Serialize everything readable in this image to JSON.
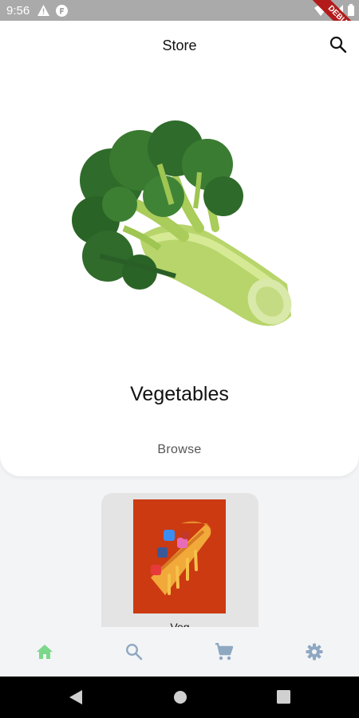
{
  "status_bar": {
    "time": "9:56",
    "debug_label": "DEBUG"
  },
  "app_bar": {
    "title": "Store"
  },
  "hero": {
    "category": "Vegetables",
    "browse_label": "Browse"
  },
  "product_card": {
    "label": "Veg"
  },
  "bottom_nav": {
    "items": [
      {
        "icon": "home-icon",
        "active": true
      },
      {
        "icon": "search-icon",
        "active": false
      },
      {
        "icon": "cart-icon",
        "active": false
      },
      {
        "icon": "settings-icon",
        "active": false
      }
    ],
    "active_color": "#7bd88a",
    "inactive_color": "#8fa8c2"
  },
  "colors": {
    "status_bar": "#aaaaaa",
    "debug_banner": "#b31b1b",
    "card_bg": "#ffffff",
    "page_bg": "#f3f4f6",
    "pizza_bg": "#cc3a12"
  }
}
